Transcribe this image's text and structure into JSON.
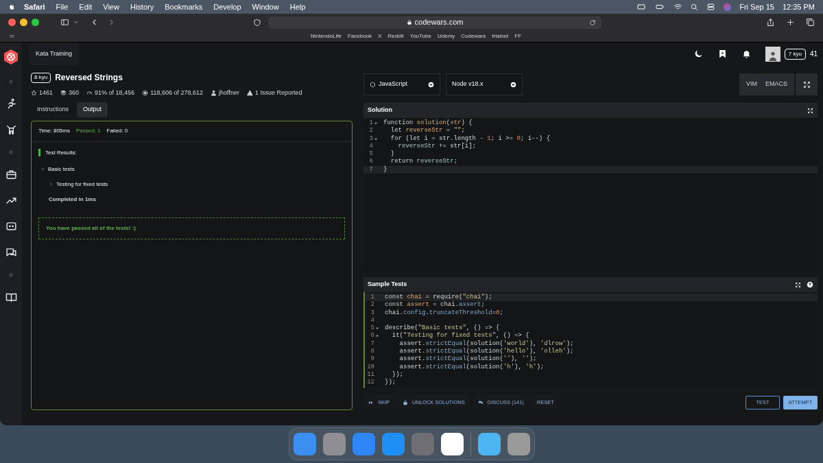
{
  "menubar": {
    "items": [
      "Safari",
      "File",
      "Edit",
      "View",
      "History",
      "Bookmarks",
      "Develop",
      "Window",
      "Help"
    ],
    "date": "Fri Sep 15",
    "time": "12:35 PM"
  },
  "browser": {
    "url": "codewars.com",
    "bookmarks": [
      "NintendoLife",
      "Facebook",
      "X",
      "Reddit",
      "YouTube",
      "Udemy",
      "Codewars",
      "trialnet",
      "FF"
    ]
  },
  "nav": {
    "breadcrumb": "Kata Training",
    "rank": "7 kyu",
    "honor": "41"
  },
  "kata": {
    "rank": "8 kyu",
    "title": "Reversed Strings",
    "stats": [
      {
        "kind": "star",
        "text": "1461"
      },
      {
        "kind": "stack",
        "text": "360"
      },
      {
        "kind": "gauge",
        "text": "91% of 18,456"
      },
      {
        "kind": "target",
        "text": "118,606 of 278,612"
      },
      {
        "kind": "user",
        "text": "jhoffner"
      },
      {
        "kind": "warning",
        "text": "1 Issue Reported"
      }
    ]
  },
  "tabs": [
    {
      "label": "Instructions",
      "selected": false
    },
    {
      "label": "Output",
      "selected": true
    }
  ],
  "output": {
    "time": "Time: 805ms",
    "passed": "Passed: 1",
    "failed": "Failed: 0",
    "heading": "Test Results:",
    "groups": [
      {
        "label": "Basic tests",
        "expanded": true,
        "children": [
          {
            "label": "Testing for fixed tests",
            "expanded": false
          }
        ],
        "completed": "Completed in 1ms"
      }
    ],
    "message": "You have passed all of the tests! :)"
  },
  "editor": {
    "language": "JavaScript",
    "version": "Node v18.x",
    "modes": [
      "VIM",
      "EMACS"
    ],
    "panels": [
      {
        "title": "Solution",
        "help": false,
        "lines": [
          {
            "number": "1",
            "fold": true,
            "active": false,
            "tokens": [
              {
                "kind": "k",
                "text": "function "
              },
              {
                "kind": "d",
                "text": "solution"
              },
              {
                "kind": "p",
                "text": "("
              },
              {
                "kind": "d",
                "text": "str"
              },
              {
                "kind": "p",
                "text": ") {"
              }
            ]
          },
          {
            "number": "2",
            "fold": false,
            "active": false,
            "tokens": [
              {
                "kind": "k",
                "text": "  let "
              },
              {
                "kind": "d",
                "text": "reverseStr"
              },
              {
                "kind": "p",
                "text": " = "
              },
              {
                "kind": "s",
                "text": "\"\""
              },
              {
                "kind": "p",
                "text": ";"
              }
            ]
          },
          {
            "number": "3",
            "fold": true,
            "active": false,
            "tokens": [
              {
                "kind": "k",
                "text": "  for "
              },
              {
                "kind": "p",
                "text": "(let i = str.length - "
              },
              {
                "kind": "n",
                "text": "1"
              },
              {
                "kind": "p",
                "text": "; i >= "
              },
              {
                "kind": "n",
                "text": "0"
              },
              {
                "kind": "p",
                "text": "; i--) {"
              }
            ]
          },
          {
            "number": "4",
            "fold": false,
            "active": false,
            "tokens": [
              {
                "kind": "v",
                "text": "    reverseStr"
              },
              {
                "kind": "p",
                "text": " += str[i];"
              }
            ]
          },
          {
            "number": "5",
            "fold": false,
            "active": false,
            "tokens": [
              {
                "kind": "p",
                "text": "  }"
              }
            ]
          },
          {
            "number": "6",
            "fold": false,
            "active": false,
            "tokens": [
              {
                "kind": "k",
                "text": "  return "
              },
              {
                "kind": "v",
                "text": "reverseStr"
              },
              {
                "kind": "p",
                "text": ";"
              }
            ]
          },
          {
            "number": "7",
            "fold": false,
            "active": true,
            "tokens": [
              {
                "kind": "p",
                "text": "}"
              }
            ]
          }
        ]
      },
      {
        "title": "Sample Tests",
        "help": true,
        "lines": [
          {
            "number": "1",
            "fold": false,
            "active": true,
            "tokens": [
              {
                "kind": "k",
                "text": "const "
              },
              {
                "kind": "d",
                "text": "chai"
              },
              {
                "kind": "p",
                "text": " = require("
              },
              {
                "kind": "s",
                "text": "\"chai\""
              },
              {
                "kind": "p",
                "text": ");"
              }
            ]
          },
          {
            "number": "2",
            "fold": false,
            "active": false,
            "tokens": [
              {
                "kind": "k",
                "text": "const "
              },
              {
                "kind": "d",
                "text": "assert"
              },
              {
                "kind": "p",
                "text": " = chai."
              },
              {
                "kind": "m",
                "text": "assert"
              },
              {
                "kind": "p",
                "text": ";"
              }
            ]
          },
          {
            "number": "3",
            "fold": false,
            "active": false,
            "tokens": [
              {
                "kind": "p",
                "text": "chai."
              },
              {
                "kind": "m",
                "text": "config"
              },
              {
                "kind": "p",
                "text": "."
              },
              {
                "kind": "m",
                "text": "truncateThreshold"
              },
              {
                "kind": "p",
                "text": "="
              },
              {
                "kind": "n",
                "text": "0"
              },
              {
                "kind": "p",
                "text": ";"
              }
            ]
          },
          {
            "number": "4",
            "fold": false,
            "active": false
          },
          {
            "number": "5",
            "fold": true,
            "active": false,
            "tokens": [
              {
                "kind": "p",
                "text": "describe("
              },
              {
                "kind": "s",
                "text": "\"Basic tests\""
              },
              {
                "kind": "p",
                "text": ", () => {"
              }
            ]
          },
          {
            "number": "6",
            "fold": true,
            "active": false,
            "tokens": [
              {
                "kind": "p",
                "text": "  it("
              },
              {
                "kind": "s",
                "text": "\"Testing for fixed tests\""
              },
              {
                "kind": "p",
                "text": ", () => {"
              }
            ]
          },
          {
            "number": "7",
            "fold": false,
            "active": false,
            "tokens": [
              {
                "kind": "p",
                "text": "    assert."
              },
              {
                "kind": "m",
                "text": "strictEqual"
              },
              {
                "kind": "p",
                "text": "(solution("
              },
              {
                "kind": "s",
                "text": "'world'"
              },
              {
                "kind": "p",
                "text": "), "
              },
              {
                "kind": "s",
                "text": "'dlrow'"
              },
              {
                "kind": "p",
                "text": ");"
              }
            ]
          },
          {
            "number": "8",
            "fold": false,
            "active": false,
            "tokens": [
              {
                "kind": "p",
                "text": "    assert."
              },
              {
                "kind": "m",
                "text": "strictEqual"
              },
              {
                "kind": "p",
                "text": "(solution("
              },
              {
                "kind": "s",
                "text": "'hello'"
              },
              {
                "kind": "p",
                "text": "), "
              },
              {
                "kind": "s",
                "text": "'olleh'"
              },
              {
                "kind": "p",
                "text": ");"
              }
            ]
          },
          {
            "number": "9",
            "fold": false,
            "active": false,
            "tokens": [
              {
                "kind": "p",
                "text": "    assert."
              },
              {
                "kind": "m",
                "text": "strictEqual"
              },
              {
                "kind": "p",
                "text": "(solution("
              },
              {
                "kind": "s",
                "text": "''"
              },
              {
                "kind": "p",
                "text": "), "
              },
              {
                "kind": "s",
                "text": "''"
              },
              {
                "kind": "p",
                "text": ");"
              }
            ]
          },
          {
            "number": "10",
            "fold": false,
            "active": false,
            "tokens": [
              {
                "kind": "p",
                "text": "    assert."
              },
              {
                "kind": "m",
                "text": "strictEqual"
              },
              {
                "kind": "p",
                "text": "(solution("
              },
              {
                "kind": "s",
                "text": "'h'"
              },
              {
                "kind": "p",
                "text": "), "
              },
              {
                "kind": "s",
                "text": "'h'"
              },
              {
                "kind": "p",
                "text": ");"
              }
            ]
          },
          {
            "number": "11",
            "fold": false,
            "active": false,
            "tokens": [
              {
                "kind": "p",
                "text": "  });"
              }
            ]
          },
          {
            "number": "12",
            "fold": false,
            "active": false,
            "tokens": [
              {
                "kind": "p",
                "text": "});"
              }
            ]
          }
        ]
      }
    ]
  },
  "actions": [
    {
      "kind": "skip",
      "label": "SKIP"
    },
    {
      "kind": "lock",
      "label": "UNLOCK SOLUTIONS"
    },
    {
      "kind": "chat",
      "label": "DISCUSS (141)"
    },
    {
      "kind": "plain",
      "label": "RESET"
    }
  ],
  "test_button": "TEST",
  "attempt_button": "ATTEMPT"
}
